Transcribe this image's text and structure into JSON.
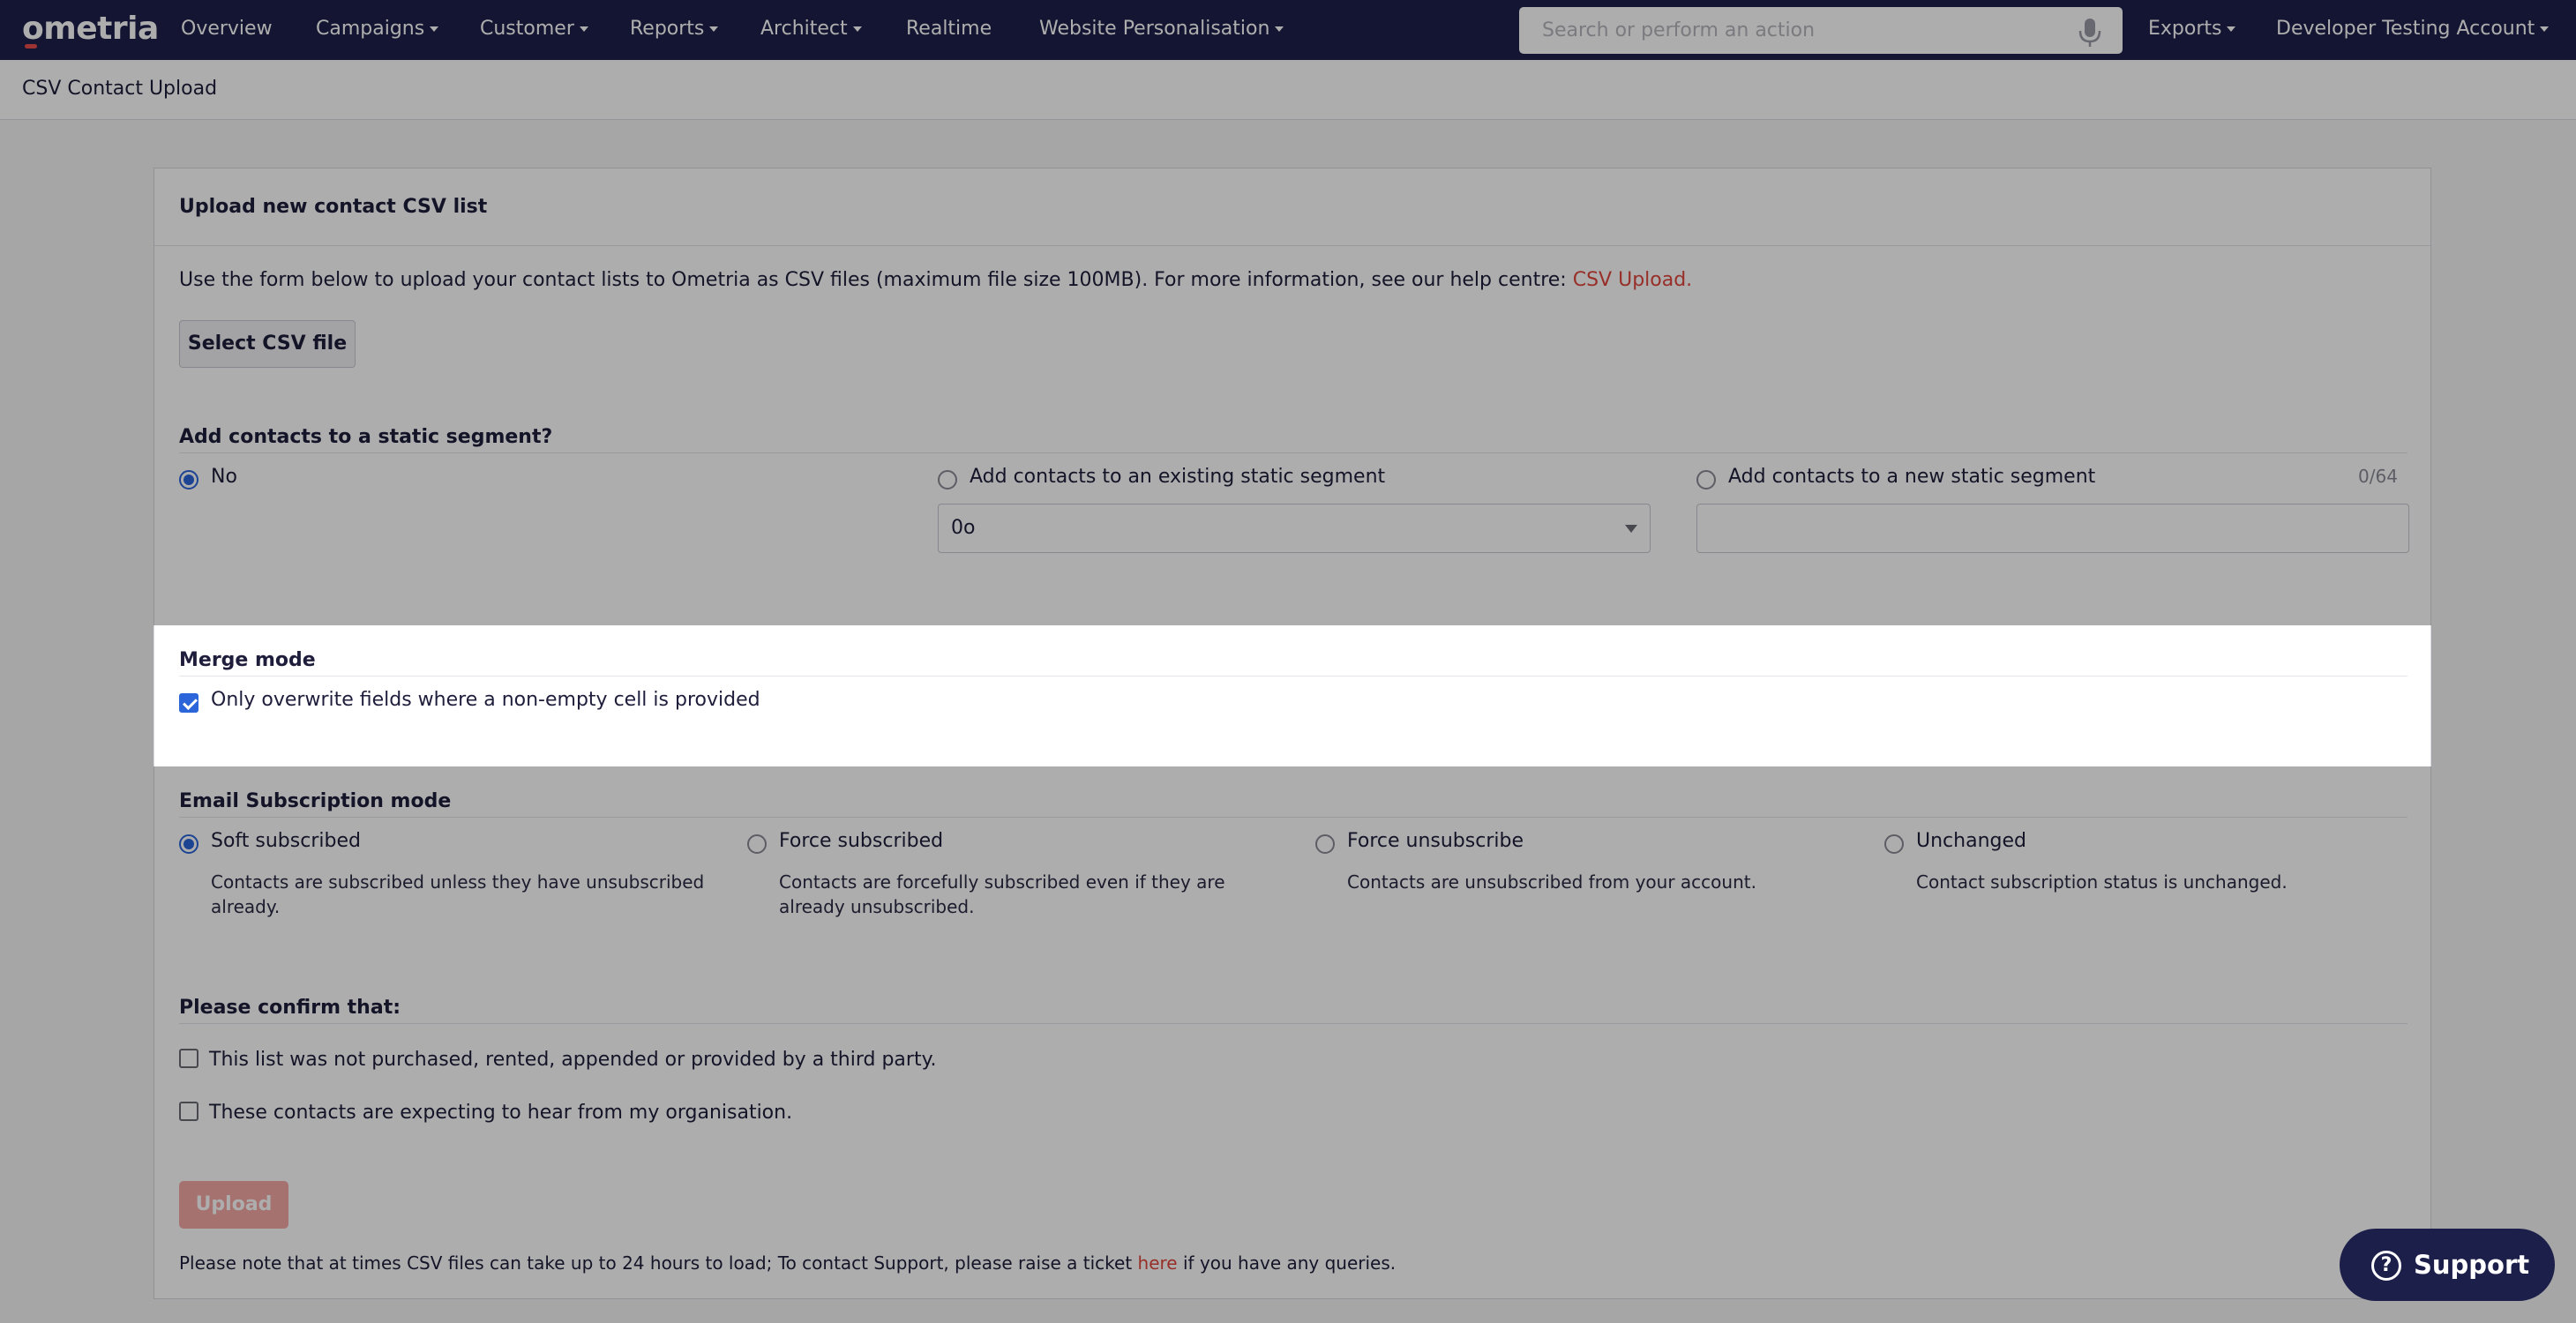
{
  "topnav": {
    "logo": "ometria",
    "items": [
      {
        "label": "Overview",
        "dropdown": false
      },
      {
        "label": "Campaigns",
        "dropdown": true
      },
      {
        "label": "Customer",
        "dropdown": true
      },
      {
        "label": "Reports",
        "dropdown": true
      },
      {
        "label": "Architect",
        "dropdown": true
      },
      {
        "label": "Realtime",
        "dropdown": false
      },
      {
        "label": "Website Personalisation",
        "dropdown": true
      }
    ],
    "search_placeholder": "Search or perform an action",
    "exports": "Exports",
    "account": "Developer Testing Account"
  },
  "breadcrumb": "CSV Contact Upload",
  "card": {
    "title": "Upload new contact CSV list",
    "intro": "Use the form below to upload your contact lists to Ometria as CSV files (maximum file size 100MB). For more information, see our help centre:",
    "intro_link": "CSV Upload.",
    "select_button": "Select CSV file",
    "segment": {
      "title": "Add contacts to a static segment?",
      "option_no": "No",
      "option_existing": "Add contacts to an existing static segment",
      "option_new": "Add contacts to a new static segment",
      "counter": "0/64",
      "existing_value": "0o",
      "selected": "no"
    },
    "merge": {
      "title": "Merge mode",
      "option": "Only overwrite fields where a non-empty cell is provided",
      "checked": true
    },
    "subscription": {
      "title": "Email Subscription mode",
      "selected": "soft",
      "options": [
        {
          "label": "Soft subscribed",
          "desc": "Contacts are subscribed unless they have unsubscribed already."
        },
        {
          "label": "Force subscribed",
          "desc": "Contacts are forcefully subscribed even if they are already unsubscribed."
        },
        {
          "label": "Force unsubscribe",
          "desc": "Contacts are unsubscribed from your account."
        },
        {
          "label": "Unchanged",
          "desc": "Contact subscription status is unchanged."
        }
      ]
    },
    "confirm": {
      "title": "Please confirm that:",
      "item1": "This list was not purchased, rented, appended or provided by a third party.",
      "item2": "These contacts are expecting to hear from my organisation."
    },
    "upload_button": "Upload",
    "footnote_pre": "Please note that at times CSV files can take up to 24 hours to load; To contact Support, please raise a ticket",
    "footnote_link": "here",
    "footnote_post": "if you have any queries."
  },
  "support": {
    "label": "Support",
    "icon": "question-circle-icon"
  },
  "colors": {
    "nav_bg": "#1c1f4a",
    "accent": "#2b65d9",
    "link": "#e0453c",
    "upload_disabled": "#f5a8a6"
  }
}
